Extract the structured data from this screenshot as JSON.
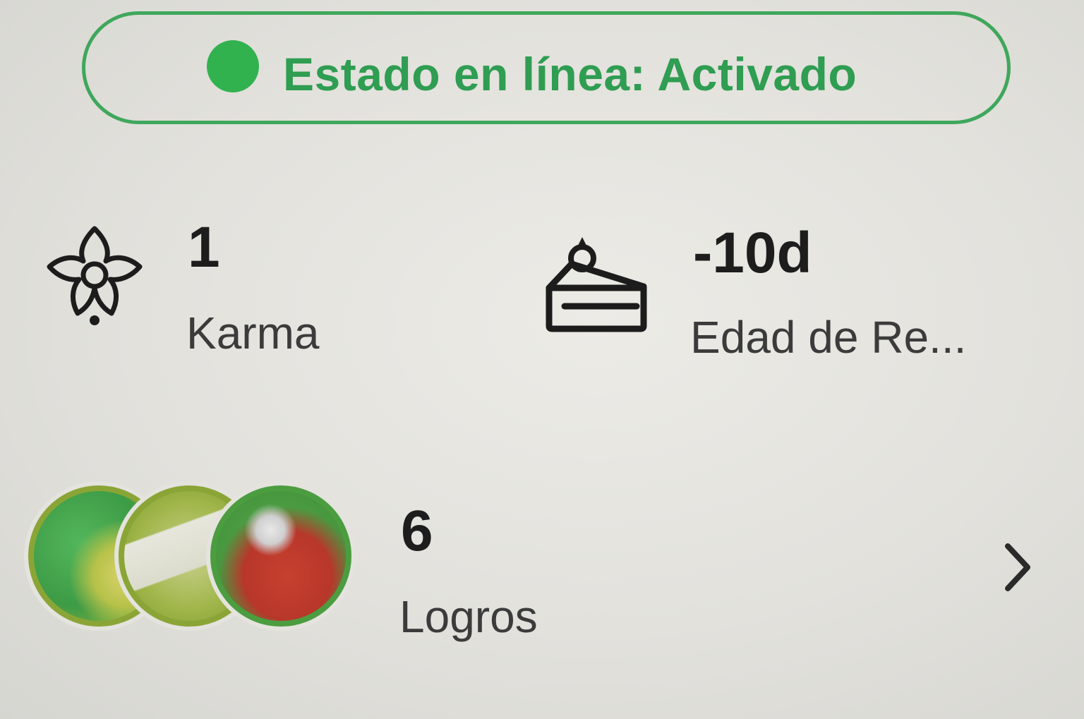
{
  "status": {
    "text": "Estado en línea: Activado",
    "color": "#2f9d52",
    "dot_color": "#31b24f"
  },
  "karma": {
    "value": "1",
    "label": "Karma",
    "icon": "flower-icon"
  },
  "account_age": {
    "value": "-10d",
    "label": "Edad de Re...",
    "icon": "cake-icon"
  },
  "achievements": {
    "value": "6",
    "label": "Logros",
    "badges": [
      "achievement-badge",
      "achievement-badge",
      "achievement-badge"
    ],
    "chevron_icon": "chevron-right-icon"
  }
}
